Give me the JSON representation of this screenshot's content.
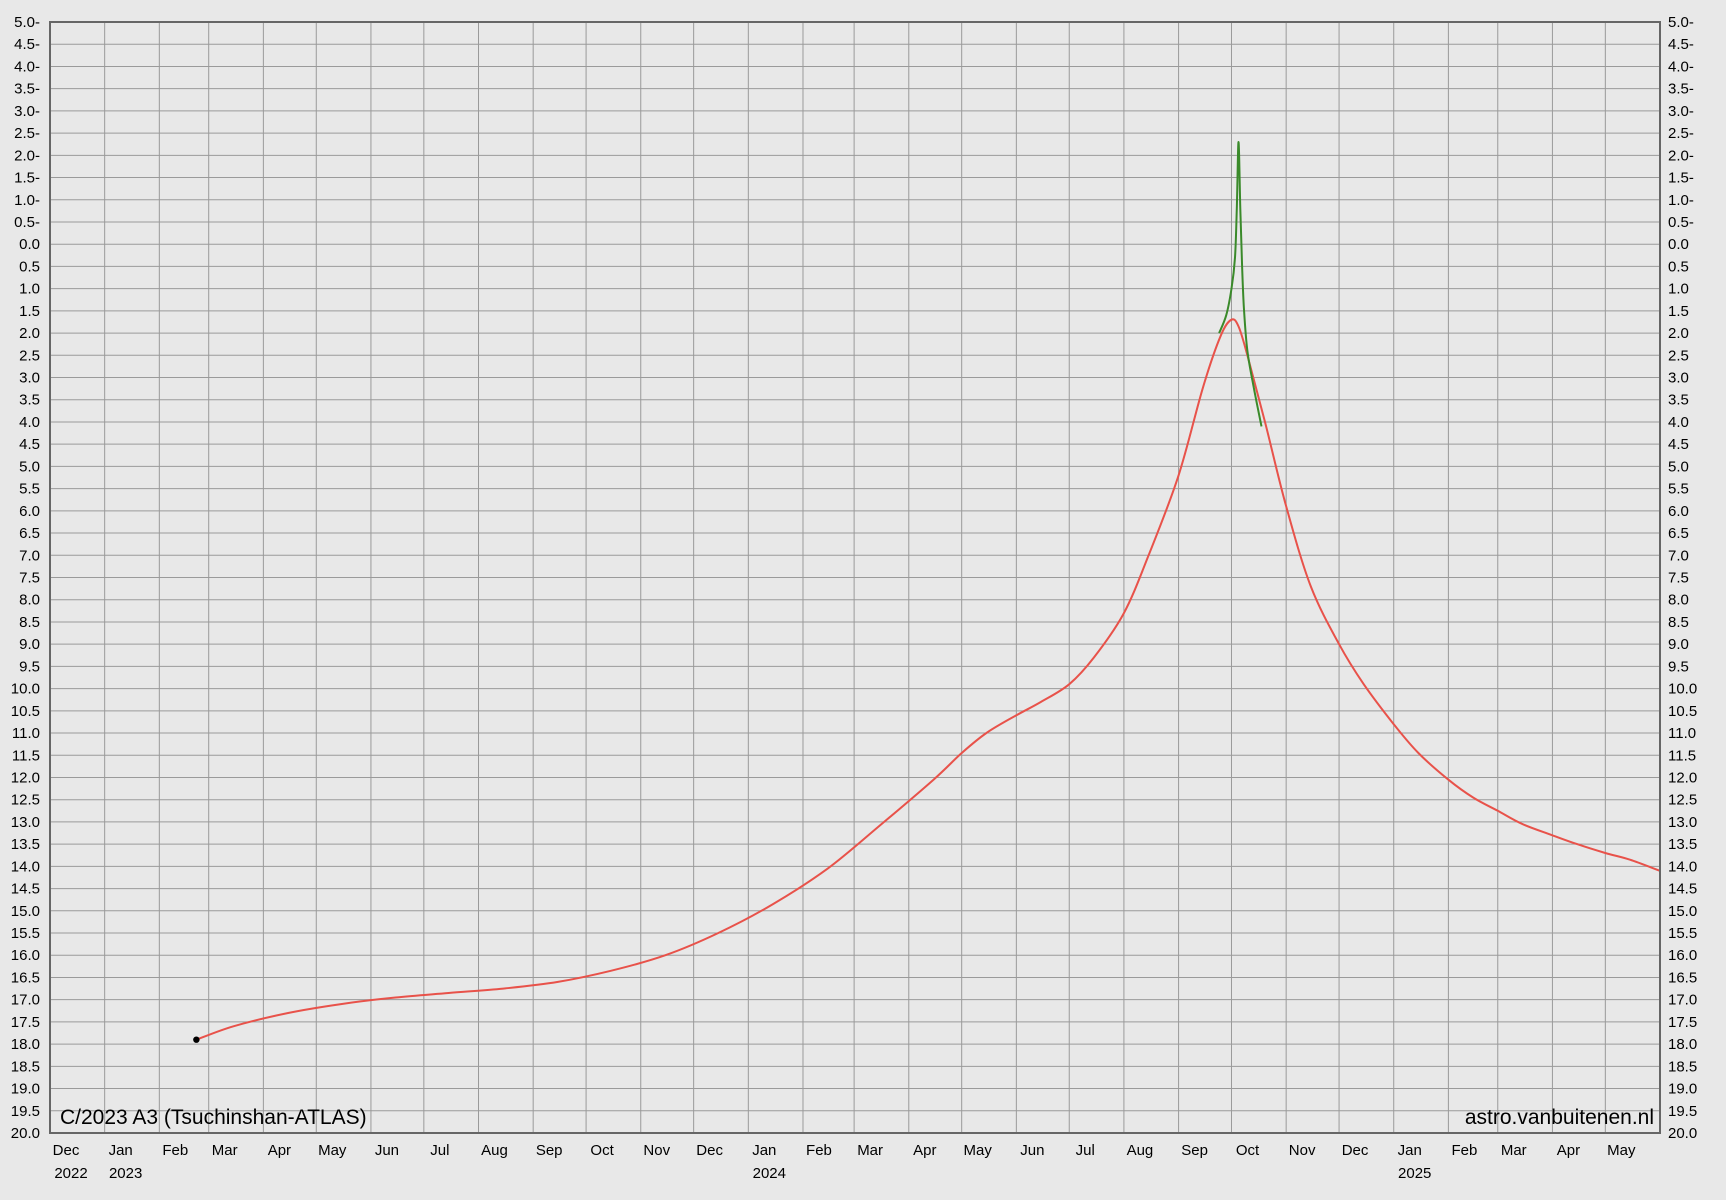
{
  "chart_data": {
    "type": "line",
    "title": "C/2023 A3 (Tsuchinshan-ATLAS)",
    "credit": "astro.vanbuitenen.nl",
    "colors": {
      "predicted": "#e8524a",
      "forward_scatter": "#3a8a2a",
      "background": "#e8e8e8",
      "grid": "#9a9a9a",
      "axis": "#666666",
      "observation": "#000000"
    },
    "y_axis": {
      "inverted": true,
      "ylim": [
        -5.0,
        20.0
      ],
      "tick_labels": [
        "5.0-",
        "4.5-",
        "4.0-",
        "3.5-",
        "3.0-",
        "2.5-",
        "2.0-",
        "1.5-",
        "1.0-",
        "0.5-",
        "0.0",
        "0.5",
        "1.0",
        "1.5",
        "2.0",
        "2.5",
        "3.0",
        "3.5",
        "4.0",
        "4.5",
        "5.0",
        "5.5",
        "6.0",
        "6.5",
        "7.0",
        "7.5",
        "8.0",
        "8.5",
        "9.0",
        "9.5",
        "10.0",
        "10.5",
        "11.0",
        "11.5",
        "12.0",
        "12.5",
        "13.0",
        "13.5",
        "14.0",
        "14.5",
        "15.0",
        "15.5",
        "16.0",
        "16.5",
        "17.0",
        "17.5",
        "18.0",
        "18.5",
        "19.0",
        "19.5",
        "20.0"
      ],
      "right_axis_mirrored": true
    },
    "x_axis": {
      "xlim": [
        "2022-12-01",
        "2025-06-01"
      ],
      "months": [
        {
          "label": "Dec",
          "year": "2022",
          "date": "2022-12-01"
        },
        {
          "label": "Jan",
          "year": "2023",
          "date": "2023-01-01"
        },
        {
          "label": "Feb",
          "year": "",
          "date": "2023-02-01"
        },
        {
          "label": "Mar",
          "year": "",
          "date": "2023-03-01"
        },
        {
          "label": "Apr",
          "year": "",
          "date": "2023-04-01"
        },
        {
          "label": "May",
          "year": "",
          "date": "2023-05-01"
        },
        {
          "label": "Jun",
          "year": "",
          "date": "2023-06-01"
        },
        {
          "label": "Jul",
          "year": "",
          "date": "2023-07-01"
        },
        {
          "label": "Aug",
          "year": "",
          "date": "2023-08-01"
        },
        {
          "label": "Sep",
          "year": "",
          "date": "2023-09-01"
        },
        {
          "label": "Oct",
          "year": "",
          "date": "2023-10-01"
        },
        {
          "label": "Nov",
          "year": "",
          "date": "2023-11-01"
        },
        {
          "label": "Dec",
          "year": "",
          "date": "2023-12-01"
        },
        {
          "label": "Jan",
          "year": "2024",
          "date": "2024-01-01"
        },
        {
          "label": "Feb",
          "year": "",
          "date": "2024-02-01"
        },
        {
          "label": "Mar",
          "year": "",
          "date": "2024-03-01"
        },
        {
          "label": "Apr",
          "year": "",
          "date": "2024-04-01"
        },
        {
          "label": "May",
          "year": "",
          "date": "2024-05-01"
        },
        {
          "label": "Jun",
          "year": "",
          "date": "2024-06-01"
        },
        {
          "label": "Jul",
          "year": "",
          "date": "2024-07-01"
        },
        {
          "label": "Aug",
          "year": "",
          "date": "2024-08-01"
        },
        {
          "label": "Sep",
          "year": "",
          "date": "2024-09-01"
        },
        {
          "label": "Oct",
          "year": "",
          "date": "2024-10-01"
        },
        {
          "label": "Nov",
          "year": "",
          "date": "2024-11-01"
        },
        {
          "label": "Dec",
          "year": "",
          "date": "2024-12-01"
        },
        {
          "label": "Jan",
          "year": "2025",
          "date": "2025-01-01"
        },
        {
          "label": "Feb",
          "year": "",
          "date": "2025-02-01"
        },
        {
          "label": "Mar",
          "year": "",
          "date": "2025-03-01"
        },
        {
          "label": "Apr",
          "year": "",
          "date": "2025-04-01"
        },
        {
          "label": "May",
          "year": "",
          "date": "2025-05-01"
        }
      ]
    },
    "grid": true,
    "series": [
      {
        "color": "#e8524a",
        "points": [
          [
            "2023-02-22",
            17.9
          ],
          [
            "2023-03-15",
            17.6
          ],
          [
            "2023-04-15",
            17.3
          ],
          [
            "2023-05-15",
            17.1
          ],
          [
            "2023-06-15",
            16.95
          ],
          [
            "2023-07-15",
            16.85
          ],
          [
            "2023-08-15",
            16.75
          ],
          [
            "2023-09-15",
            16.6
          ],
          [
            "2023-10-15",
            16.35
          ],
          [
            "2023-11-15",
            16.0
          ],
          [
            "2023-12-15",
            15.5
          ],
          [
            "2024-01-15",
            14.85
          ],
          [
            "2024-02-15",
            14.05
          ],
          [
            "2024-03-15",
            13.1
          ],
          [
            "2024-04-15",
            12.05
          ],
          [
            "2024-05-01",
            11.45
          ],
          [
            "2024-05-15",
            11.0
          ],
          [
            "2024-06-01",
            10.6
          ],
          [
            "2024-06-15",
            10.3
          ],
          [
            "2024-07-01",
            9.9
          ],
          [
            "2024-07-15",
            9.3
          ],
          [
            "2024-08-01",
            8.3
          ],
          [
            "2024-08-15",
            7.0
          ],
          [
            "2024-09-01",
            5.2
          ],
          [
            "2024-09-15",
            3.2
          ],
          [
            "2024-09-25",
            2.05
          ],
          [
            "2024-10-01",
            1.7
          ],
          [
            "2024-10-05",
            1.85
          ],
          [
            "2024-10-10",
            2.5
          ],
          [
            "2024-10-20",
            4.0
          ],
          [
            "2024-11-01",
            5.9
          ],
          [
            "2024-11-15",
            7.7
          ],
          [
            "2024-12-01",
            9.0
          ],
          [
            "2024-12-15",
            9.9
          ],
          [
            "2025-01-01",
            10.8
          ],
          [
            "2025-01-15",
            11.45
          ],
          [
            "2025-02-01",
            12.05
          ],
          [
            "2025-02-15",
            12.45
          ],
          [
            "2025-03-01",
            12.75
          ],
          [
            "2025-03-15",
            13.05
          ],
          [
            "2025-04-01",
            13.3
          ],
          [
            "2025-04-15",
            13.5
          ],
          [
            "2025-05-01",
            13.7
          ],
          [
            "2025-05-15",
            13.85
          ],
          [
            "2025-06-01",
            14.1
          ]
        ]
      },
      {
        "color": "#3a8a2a",
        "points": [
          [
            "2024-09-24",
            2.0
          ],
          [
            "2024-09-28",
            1.6
          ],
          [
            "2024-10-01",
            1.0
          ],
          [
            "2024-10-03",
            0.3
          ],
          [
            "2024-10-04",
            -0.8
          ],
          [
            "2024-10-05",
            -2.3
          ],
          [
            "2024-10-06",
            -0.8
          ],
          [
            "2024-10-07",
            0.5
          ],
          [
            "2024-10-08",
            1.4
          ],
          [
            "2024-10-10",
            2.4
          ],
          [
            "2024-10-14",
            3.3
          ],
          [
            "2024-10-18",
            4.1
          ]
        ]
      }
    ],
    "observations": [
      {
        "date": "2023-02-22",
        "mag": 17.9
      }
    ]
  }
}
